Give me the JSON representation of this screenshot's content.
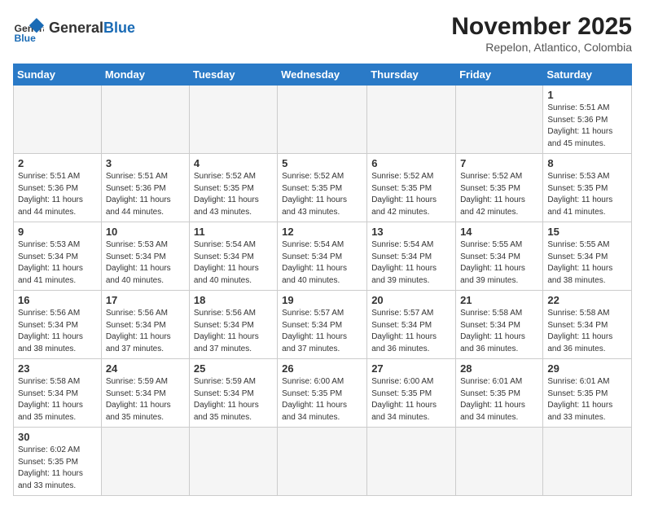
{
  "header": {
    "logo_general": "General",
    "logo_blue": "Blue",
    "month_title": "November 2025",
    "location": "Repelon, Atlantico, Colombia"
  },
  "days_of_week": [
    "Sunday",
    "Monday",
    "Tuesday",
    "Wednesday",
    "Thursday",
    "Friday",
    "Saturday"
  ],
  "weeks": [
    [
      {
        "day": "",
        "info": ""
      },
      {
        "day": "",
        "info": ""
      },
      {
        "day": "",
        "info": ""
      },
      {
        "day": "",
        "info": ""
      },
      {
        "day": "",
        "info": ""
      },
      {
        "day": "",
        "info": ""
      },
      {
        "day": "1",
        "info": "Sunrise: 5:51 AM\nSunset: 5:36 PM\nDaylight: 11 hours\nand 45 minutes."
      }
    ],
    [
      {
        "day": "2",
        "info": "Sunrise: 5:51 AM\nSunset: 5:36 PM\nDaylight: 11 hours\nand 44 minutes."
      },
      {
        "day": "3",
        "info": "Sunrise: 5:51 AM\nSunset: 5:36 PM\nDaylight: 11 hours\nand 44 minutes."
      },
      {
        "day": "4",
        "info": "Sunrise: 5:52 AM\nSunset: 5:35 PM\nDaylight: 11 hours\nand 43 minutes."
      },
      {
        "day": "5",
        "info": "Sunrise: 5:52 AM\nSunset: 5:35 PM\nDaylight: 11 hours\nand 43 minutes."
      },
      {
        "day": "6",
        "info": "Sunrise: 5:52 AM\nSunset: 5:35 PM\nDaylight: 11 hours\nand 42 minutes."
      },
      {
        "day": "7",
        "info": "Sunrise: 5:52 AM\nSunset: 5:35 PM\nDaylight: 11 hours\nand 42 minutes."
      },
      {
        "day": "8",
        "info": "Sunrise: 5:53 AM\nSunset: 5:35 PM\nDaylight: 11 hours\nand 41 minutes."
      }
    ],
    [
      {
        "day": "9",
        "info": "Sunrise: 5:53 AM\nSunset: 5:34 PM\nDaylight: 11 hours\nand 41 minutes."
      },
      {
        "day": "10",
        "info": "Sunrise: 5:53 AM\nSunset: 5:34 PM\nDaylight: 11 hours\nand 40 minutes."
      },
      {
        "day": "11",
        "info": "Sunrise: 5:54 AM\nSunset: 5:34 PM\nDaylight: 11 hours\nand 40 minutes."
      },
      {
        "day": "12",
        "info": "Sunrise: 5:54 AM\nSunset: 5:34 PM\nDaylight: 11 hours\nand 40 minutes."
      },
      {
        "day": "13",
        "info": "Sunrise: 5:54 AM\nSunset: 5:34 PM\nDaylight: 11 hours\nand 39 minutes."
      },
      {
        "day": "14",
        "info": "Sunrise: 5:55 AM\nSunset: 5:34 PM\nDaylight: 11 hours\nand 39 minutes."
      },
      {
        "day": "15",
        "info": "Sunrise: 5:55 AM\nSunset: 5:34 PM\nDaylight: 11 hours\nand 38 minutes."
      }
    ],
    [
      {
        "day": "16",
        "info": "Sunrise: 5:56 AM\nSunset: 5:34 PM\nDaylight: 11 hours\nand 38 minutes."
      },
      {
        "day": "17",
        "info": "Sunrise: 5:56 AM\nSunset: 5:34 PM\nDaylight: 11 hours\nand 37 minutes."
      },
      {
        "day": "18",
        "info": "Sunrise: 5:56 AM\nSunset: 5:34 PM\nDaylight: 11 hours\nand 37 minutes."
      },
      {
        "day": "19",
        "info": "Sunrise: 5:57 AM\nSunset: 5:34 PM\nDaylight: 11 hours\nand 37 minutes."
      },
      {
        "day": "20",
        "info": "Sunrise: 5:57 AM\nSunset: 5:34 PM\nDaylight: 11 hours\nand 36 minutes."
      },
      {
        "day": "21",
        "info": "Sunrise: 5:58 AM\nSunset: 5:34 PM\nDaylight: 11 hours\nand 36 minutes."
      },
      {
        "day": "22",
        "info": "Sunrise: 5:58 AM\nSunset: 5:34 PM\nDaylight: 11 hours\nand 36 minutes."
      }
    ],
    [
      {
        "day": "23",
        "info": "Sunrise: 5:58 AM\nSunset: 5:34 PM\nDaylight: 11 hours\nand 35 minutes."
      },
      {
        "day": "24",
        "info": "Sunrise: 5:59 AM\nSunset: 5:34 PM\nDaylight: 11 hours\nand 35 minutes."
      },
      {
        "day": "25",
        "info": "Sunrise: 5:59 AM\nSunset: 5:34 PM\nDaylight: 11 hours\nand 35 minutes."
      },
      {
        "day": "26",
        "info": "Sunrise: 6:00 AM\nSunset: 5:35 PM\nDaylight: 11 hours\nand 34 minutes."
      },
      {
        "day": "27",
        "info": "Sunrise: 6:00 AM\nSunset: 5:35 PM\nDaylight: 11 hours\nand 34 minutes."
      },
      {
        "day": "28",
        "info": "Sunrise: 6:01 AM\nSunset: 5:35 PM\nDaylight: 11 hours\nand 34 minutes."
      },
      {
        "day": "29",
        "info": "Sunrise: 6:01 AM\nSunset: 5:35 PM\nDaylight: 11 hours\nand 33 minutes."
      }
    ],
    [
      {
        "day": "30",
        "info": "Sunrise: 6:02 AM\nSunset: 5:35 PM\nDaylight: 11 hours\nand 33 minutes."
      },
      {
        "day": "",
        "info": ""
      },
      {
        "day": "",
        "info": ""
      },
      {
        "day": "",
        "info": ""
      },
      {
        "day": "",
        "info": ""
      },
      {
        "day": "",
        "info": ""
      },
      {
        "day": "",
        "info": ""
      }
    ]
  ]
}
